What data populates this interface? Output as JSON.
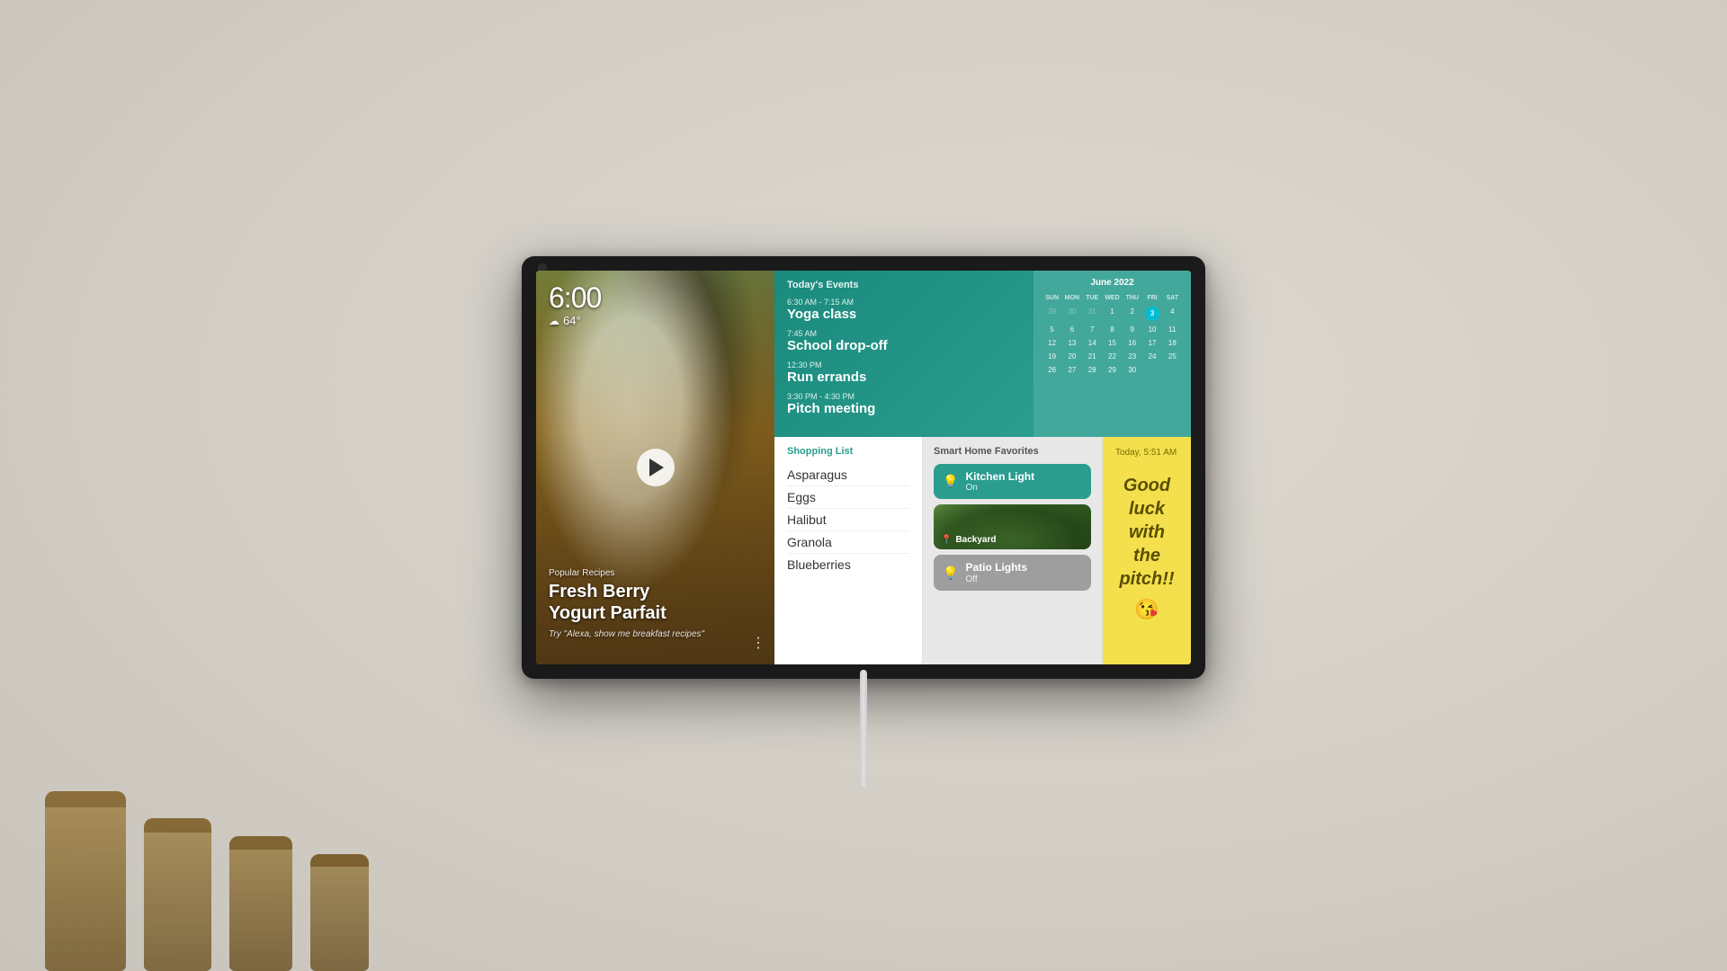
{
  "device": {
    "time": "6:00",
    "weather": {
      "icon": "☁",
      "temperature": "64°"
    }
  },
  "recipe": {
    "category": "Popular Recipes",
    "title": "Fresh Berry\nYogurt Parfait",
    "prompt": "Try \"Alexa, show me breakfast recipes\""
  },
  "events": {
    "title": "Today's Events",
    "items": [
      {
        "time": "6:30 AM - 7:15 AM",
        "name": "Yoga class"
      },
      {
        "time": "7:45 AM",
        "name": "School drop-off"
      },
      {
        "time": "12:30 PM",
        "name": "Run errands"
      },
      {
        "time": "3:30 PM - 4:30 PM",
        "name": "Pitch meeting"
      }
    ]
  },
  "calendar": {
    "title": "June 2022",
    "headers": [
      "SUN",
      "MON",
      "TUE",
      "WED",
      "THU",
      "FRI",
      "SAT"
    ],
    "weeks": [
      [
        "29",
        "30",
        "31",
        "1",
        "2",
        "3",
        "4"
      ],
      [
        "5",
        "6",
        "7",
        "8",
        "9",
        "10",
        "11"
      ],
      [
        "12",
        "13",
        "14",
        "15",
        "16",
        "17",
        "18"
      ],
      [
        "19",
        "20",
        "21",
        "22",
        "23",
        "24",
        "25"
      ],
      [
        "26",
        "27",
        "28",
        "29",
        "30",
        "",
        ""
      ]
    ],
    "today": "3"
  },
  "shopping": {
    "title": "Shopping List",
    "items": [
      "Asparagus",
      "Eggs",
      "Halibut",
      "Granola",
      "Blueberries"
    ]
  },
  "smart_home": {
    "title": "Smart Home Favorites",
    "devices": [
      {
        "name": "Kitchen Light",
        "status": "On",
        "state": "on",
        "icon": "💡"
      },
      {
        "name": "Backyard",
        "status": "",
        "state": "image",
        "icon": "📍"
      },
      {
        "name": "Patio Lights",
        "status": "Off",
        "state": "off",
        "icon": "💡"
      }
    ]
  },
  "note": {
    "timestamp": "Today, 5:51 AM",
    "content": "Good luck\nwith the\npitch!!",
    "emoji": "😘"
  },
  "colors": {
    "teal": "#2a9d8f",
    "note_bg": "#f4e04d",
    "device_on": "#2a9d8f",
    "device_off": "#9e9e9e"
  }
}
